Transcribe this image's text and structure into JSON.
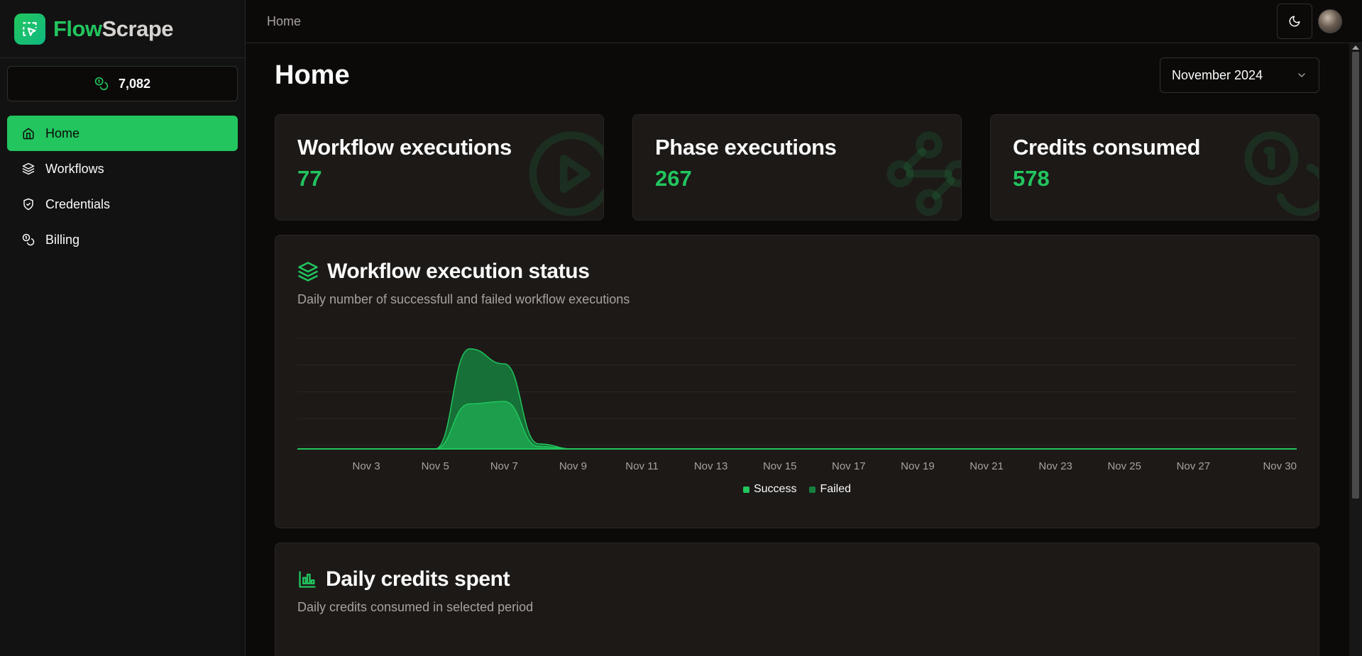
{
  "brand": {
    "flow": "Flow",
    "scrape": "Scrape"
  },
  "credits_balance": "7,082",
  "nav": [
    {
      "label": "Home",
      "icon": "home-icon",
      "active": true
    },
    {
      "label": "Workflows",
      "icon": "layers-icon",
      "active": false
    },
    {
      "label": "Credentials",
      "icon": "shield-check-icon",
      "active": false
    },
    {
      "label": "Billing",
      "icon": "coins-icon",
      "active": false
    }
  ],
  "topbar": {
    "breadcrumb": "Home"
  },
  "page": {
    "title": "Home",
    "period": "November 2024"
  },
  "stats": [
    {
      "label": "Workflow executions",
      "value": "77",
      "icon": "circle-play-icon"
    },
    {
      "label": "Phase executions",
      "value": "267",
      "icon": "waypoints-icon"
    },
    {
      "label": "Credits consumed",
      "value": "578",
      "icon": "coins-icon"
    }
  ],
  "execution_status": {
    "title": "Workflow execution status",
    "subtitle": "Daily number of successfull and failed workflow executions",
    "legend": {
      "success": "Success",
      "failed": "Failed"
    }
  },
  "daily_credits": {
    "title": "Daily credits spent",
    "subtitle": "Daily credits consumed in selected period"
  },
  "colors": {
    "accent": "#22c55e",
    "success": "#22c55e",
    "failed": "#15803d",
    "card": "#1c1917"
  },
  "chart_data": {
    "type": "area",
    "stacked": true,
    "x": [
      "Nov 1",
      "Nov 2",
      "Nov 3",
      "Nov 4",
      "Nov 5",
      "Nov 6",
      "Nov 7",
      "Nov 8",
      "Nov 9",
      "Nov 10",
      "Nov 11",
      "Nov 12",
      "Nov 13",
      "Nov 14",
      "Nov 15",
      "Nov 16",
      "Nov 17",
      "Nov 18",
      "Nov 19",
      "Nov 20",
      "Nov 21",
      "Nov 22",
      "Nov 23",
      "Nov 24",
      "Nov 25",
      "Nov 26",
      "Nov 27",
      "Nov 28",
      "Nov 29",
      "Nov 30"
    ],
    "tick_labels": [
      "Nov 3",
      "Nov 5",
      "Nov 7",
      "Nov 9",
      "Nov 11",
      "Nov 13",
      "Nov 15",
      "Nov 17",
      "Nov 19",
      "Nov 21",
      "Nov 23",
      "Nov 25",
      "Nov 27",
      "Nov 30"
    ],
    "series": [
      {
        "name": "Success",
        "color": "#22c55e",
        "values": [
          0,
          0,
          0,
          0,
          0,
          18,
          19,
          1,
          0,
          0,
          0,
          0,
          0,
          0,
          0,
          0,
          0,
          0,
          0,
          0,
          0,
          0,
          0,
          0,
          0,
          0,
          0,
          0,
          0,
          0
        ]
      },
      {
        "name": "Failed",
        "color": "#15803d",
        "values": [
          0,
          0,
          0,
          0,
          0,
          22,
          15,
          1,
          0,
          0,
          0,
          0,
          0,
          0,
          0,
          0,
          0,
          0,
          0,
          0,
          0,
          0,
          0,
          0,
          0,
          0,
          0,
          0,
          0,
          0
        ]
      }
    ],
    "grid": true,
    "legend": "bottom"
  }
}
